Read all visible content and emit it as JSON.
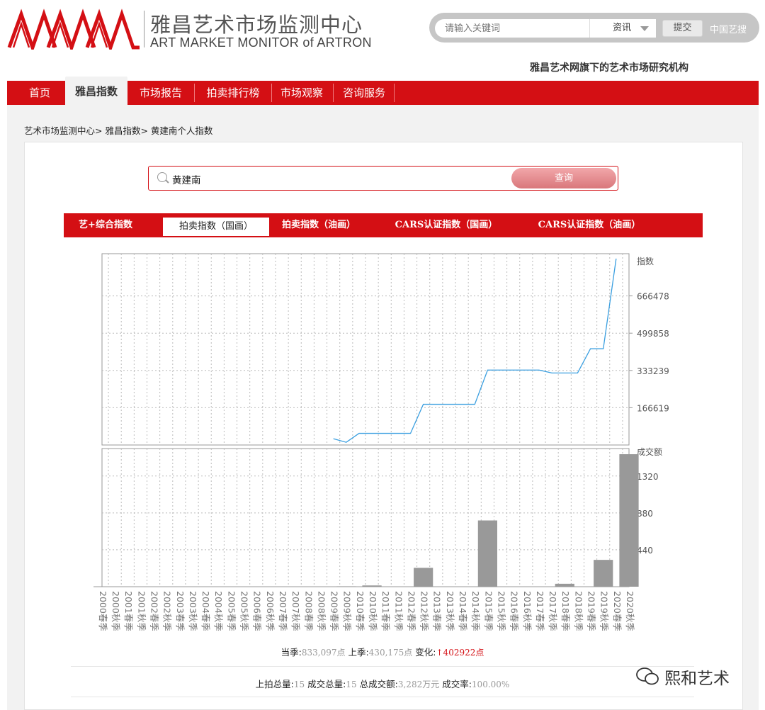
{
  "header": {
    "brand_cn": "雅昌艺术市场监测中心",
    "brand_en": "ART MARKET MONITOR of ARTRON",
    "search_placeholder": "请输入关键词",
    "search_category": "资讯",
    "submit_label": "提交",
    "cn_search_label": "中国艺搜",
    "tagline": "雅昌艺术网旗下的艺术市场研究机构"
  },
  "nav": {
    "items": [
      "首页",
      "雅昌指数",
      "市场报告",
      "拍卖排行榜",
      "市场观察",
      "咨询服务"
    ],
    "active": "雅昌指数"
  },
  "breadcrumb": "艺术市场监测中心> 雅昌指数> 黄建南个人指数",
  "query": {
    "value": "黄建南",
    "button": "查询"
  },
  "tabs": {
    "items": [
      "艺+综合指数",
      "拍卖指数（国画）",
      "拍卖指数（油画）",
      "CARS认证指数（国画）",
      "CARS认证指数（油画）"
    ],
    "active": "拍卖指数（国画）"
  },
  "chart_data": [
    {
      "type": "line",
      "ylabel": "指数",
      "y_ticks": [
        166619,
        333239,
        499858,
        666478
      ],
      "ylim": [
        0,
        833097
      ],
      "grid": true,
      "x": [
        "2000春季",
        "2000秋季",
        "2001春季",
        "2001秋季",
        "2002春季",
        "2002秋季",
        "2003春季",
        "2003秋季",
        "2004春季",
        "2004秋季",
        "2005春季",
        "2005秋季",
        "2006春季",
        "2006秋季",
        "2007春季",
        "2007秋季",
        "2008春季",
        "2008秋季",
        "2009春季",
        "2009秋季",
        "2010春季",
        "2010秋季",
        "2011春季",
        "2011秋季",
        "2012春季",
        "2012秋季",
        "2013春季",
        "2013秋季",
        "2014春季",
        "2014秋季",
        "2015春季",
        "2015秋季",
        "2016春季",
        "2016秋季",
        "2017春季",
        "2017秋季",
        "2018春季",
        "2018秋季",
        "2019春季",
        "2019秋季",
        "2020春季",
        "2020秋季"
      ],
      "series": [
        {
          "values": [
            null,
            null,
            null,
            null,
            null,
            null,
            null,
            null,
            null,
            null,
            null,
            null,
            null,
            null,
            null,
            null,
            null,
            null,
            null,
            null,
            null,
            null,
            null,
            null,
            null,
            null,
            null,
            null,
            null,
            null,
            null,
            null,
            null,
            null,
            null,
            null,
            null,
            null,
            null,
            null,
            null,
            null
          ],
          "points": {
            "2009春季": 28000,
            "2009秋季": 12000,
            "2010春季": 52000,
            "2010秋季": 52000,
            "2011春季": 52000,
            "2011秋季": 52000,
            "2012春季": 52000,
            "2012秋季": 182000,
            "2013春季": 182000,
            "2013秋季": 182000,
            "2014春季": 182000,
            "2014秋季": 182000,
            "2015春季": 335000,
            "2015秋季": 335000,
            "2016春季": 335000,
            "2016秋季": 335000,
            "2017春季": 335000,
            "2017秋季": 322000,
            "2018春季": 322000,
            "2018秋季": 322000,
            "2019春季": 430175,
            "2019秋季": 430175,
            "2020春季": 833097
          }
        }
      ]
    },
    {
      "type": "bar",
      "ylabel": "成交额",
      "y_ticks": [
        440,
        880,
        1320
      ],
      "ylim": [
        0,
        1580
      ],
      "grid": true,
      "bars": {
        "2009秋季": 5,
        "2010秋季": 15,
        "2012秋季": 225,
        "2015春季": 790,
        "2018春季": 35,
        "2019秋季": 320,
        "2020秋季": 1580
      }
    }
  ],
  "stats": {
    "current_label": "当季:",
    "current_value": "833,097点",
    "prev_label": "上季:",
    "prev_value": "430,175点",
    "change_label": "变化:",
    "change_value": "↑402922点",
    "lots_label": "上拍总量:",
    "lots_value": "15",
    "sold_label": "成交总量:",
    "sold_value": "15",
    "amount_label": "总成交额:",
    "amount_value": "3,282万元",
    "rate_label": "成交率:",
    "rate_value": "100.00%"
  },
  "watermark": "熙和艺术",
  "colors": {
    "brand_red": "#d40f14",
    "line": "#3a9fe0",
    "bar": "#999999"
  }
}
